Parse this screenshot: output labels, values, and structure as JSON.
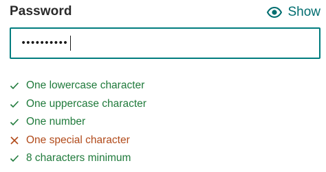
{
  "field": {
    "label": "Password",
    "show_label": "Show",
    "show_icon": "eye-icon",
    "masked_value": "••••••••••"
  },
  "colors": {
    "accent": "#007c7e",
    "pass": "#1f7a3b",
    "fail": "#b14a1a",
    "label": "#2a2a2a"
  },
  "requirements": [
    {
      "text": "One lowercase character",
      "met": true,
      "icon": "check-icon"
    },
    {
      "text": "One uppercase character",
      "met": true,
      "icon": "check-icon"
    },
    {
      "text": "One number",
      "met": true,
      "icon": "check-icon"
    },
    {
      "text": "One special character",
      "met": false,
      "icon": "cross-icon"
    },
    {
      "text": "8 characters minimum",
      "met": true,
      "icon": "check-icon"
    }
  ]
}
